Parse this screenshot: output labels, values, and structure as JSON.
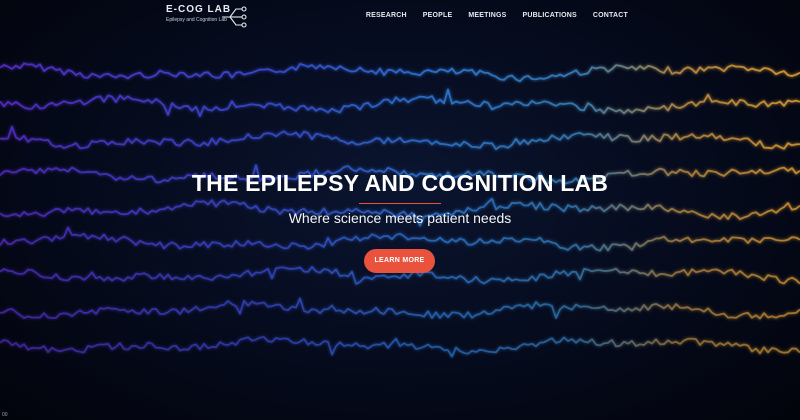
{
  "logo": {
    "title": "E-COG LAB",
    "subtitle": "Epilepsy and Cognition Lab"
  },
  "nav": {
    "items": [
      "RESEARCH",
      "PEOPLE",
      "MEETINGS",
      "PUBLICATIONS",
      "CONTACT"
    ]
  },
  "hero": {
    "title": "THE EPILEPSY AND COGNITION LAB",
    "subtitle": "Where science meets patient needs",
    "cta_label": "LEARN MORE"
  },
  "corner_text": "00",
  "colors": {
    "accent": "#e9533d",
    "wave_left": "#6a3cf0",
    "wave_mid": "#2f7fe0",
    "wave_right": "#e0a83a",
    "background": "#050a1c"
  },
  "icons": {
    "logo_graphic": "circuit-icon"
  }
}
